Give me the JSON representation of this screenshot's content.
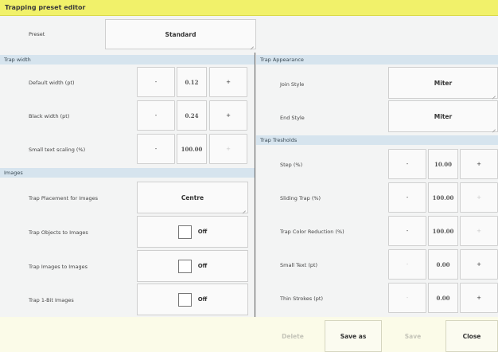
{
  "window": {
    "title": "Trapping preset editor"
  },
  "preset": {
    "label": "Preset",
    "value": "Standard"
  },
  "trap_width": {
    "header": "Trap width",
    "rows": [
      {
        "label": "Default width (pt)",
        "minus": "-",
        "value": "0.12",
        "plus": "+"
      },
      {
        "label": "Black width (pt)",
        "minus": "-",
        "value": "0.24",
        "plus": "+"
      },
      {
        "label": "Small text scaling (%)",
        "minus": "-",
        "value": "100.00",
        "plus": "+"
      }
    ]
  },
  "images": {
    "header": "Images",
    "placement": {
      "label": "Trap Placement for Images",
      "value": "Centre"
    },
    "toggles": [
      {
        "label": "Trap Objects to Images",
        "value": "Off"
      },
      {
        "label": "Trap Images to Images",
        "value": "Off"
      },
      {
        "label": "Trap 1-Bit Images",
        "value": "Off"
      }
    ]
  },
  "appearance": {
    "header": "Trap Appearance",
    "join": {
      "label": "Join Style",
      "value": "Miter"
    },
    "end": {
      "label": "End Style",
      "value": "Miter"
    }
  },
  "thresholds": {
    "header": "Trap Tresholds",
    "rows": [
      {
        "label": "Step (%)",
        "minus": "-",
        "value": "10.00",
        "plus": "+"
      },
      {
        "label": "Sliding Trap (%)",
        "minus": "-",
        "value": "100.00",
        "plus": "+"
      },
      {
        "label": "Trap Color Reduction (%)",
        "minus": "-",
        "value": "100.00",
        "plus": "+"
      },
      {
        "label": "Small Text (pt)",
        "minus": "-",
        "value": "0.00",
        "plus": "+"
      },
      {
        "label": "Thin Strokes (pt)",
        "minus": "-",
        "value": "0.00",
        "plus": "+"
      }
    ]
  },
  "footer": {
    "delete": "Delete",
    "save_as": "Save as",
    "save": "Save",
    "close": "Close"
  },
  "colors": {
    "titlebar": "#f1f16a",
    "section_header": "#d6e4ee",
    "footer": "#fbfbe8"
  }
}
